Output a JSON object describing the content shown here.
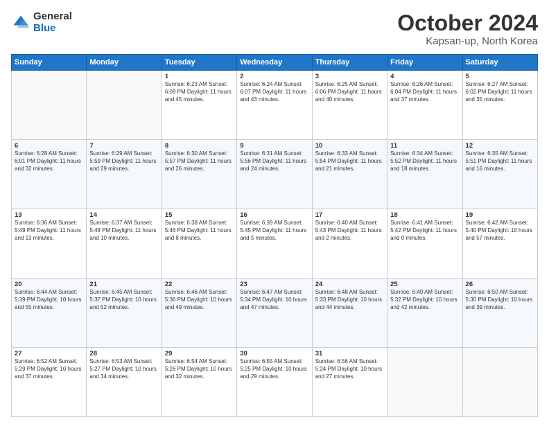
{
  "header": {
    "logo_general": "General",
    "logo_blue": "Blue",
    "title": "October 2024",
    "location": "Kapsan-up, North Korea"
  },
  "days_of_week": [
    "Sunday",
    "Monday",
    "Tuesday",
    "Wednesday",
    "Thursday",
    "Friday",
    "Saturday"
  ],
  "weeks": [
    [
      {
        "day": "",
        "info": ""
      },
      {
        "day": "",
        "info": ""
      },
      {
        "day": "1",
        "info": "Sunrise: 6:23 AM\nSunset: 6:09 PM\nDaylight: 11 hours and 45 minutes."
      },
      {
        "day": "2",
        "info": "Sunrise: 6:24 AM\nSunset: 6:07 PM\nDaylight: 11 hours and 43 minutes."
      },
      {
        "day": "3",
        "info": "Sunrise: 6:25 AM\nSunset: 6:06 PM\nDaylight: 11 hours and 40 minutes."
      },
      {
        "day": "4",
        "info": "Sunrise: 6:26 AM\nSunset: 6:04 PM\nDaylight: 11 hours and 37 minutes."
      },
      {
        "day": "5",
        "info": "Sunrise: 6:27 AM\nSunset: 6:02 PM\nDaylight: 11 hours and 35 minutes."
      }
    ],
    [
      {
        "day": "6",
        "info": "Sunrise: 6:28 AM\nSunset: 6:01 PM\nDaylight: 11 hours and 32 minutes."
      },
      {
        "day": "7",
        "info": "Sunrise: 6:29 AM\nSunset: 5:59 PM\nDaylight: 11 hours and 29 minutes."
      },
      {
        "day": "8",
        "info": "Sunrise: 6:30 AM\nSunset: 5:57 PM\nDaylight: 11 hours and 26 minutes."
      },
      {
        "day": "9",
        "info": "Sunrise: 6:31 AM\nSunset: 5:56 PM\nDaylight: 11 hours and 24 minutes."
      },
      {
        "day": "10",
        "info": "Sunrise: 6:33 AM\nSunset: 5:54 PM\nDaylight: 11 hours and 21 minutes."
      },
      {
        "day": "11",
        "info": "Sunrise: 6:34 AM\nSunset: 5:52 PM\nDaylight: 11 hours and 18 minutes."
      },
      {
        "day": "12",
        "info": "Sunrise: 6:35 AM\nSunset: 5:51 PM\nDaylight: 11 hours and 16 minutes."
      }
    ],
    [
      {
        "day": "13",
        "info": "Sunrise: 6:36 AM\nSunset: 5:49 PM\nDaylight: 11 hours and 13 minutes."
      },
      {
        "day": "14",
        "info": "Sunrise: 6:37 AM\nSunset: 5:48 PM\nDaylight: 11 hours and 10 minutes."
      },
      {
        "day": "15",
        "info": "Sunrise: 6:38 AM\nSunset: 5:46 PM\nDaylight: 11 hours and 8 minutes."
      },
      {
        "day": "16",
        "info": "Sunrise: 6:39 AM\nSunset: 5:45 PM\nDaylight: 11 hours and 5 minutes."
      },
      {
        "day": "17",
        "info": "Sunrise: 6:40 AM\nSunset: 5:43 PM\nDaylight: 11 hours and 2 minutes."
      },
      {
        "day": "18",
        "info": "Sunrise: 6:41 AM\nSunset: 5:42 PM\nDaylight: 11 hours and 0 minutes."
      },
      {
        "day": "19",
        "info": "Sunrise: 6:42 AM\nSunset: 5:40 PM\nDaylight: 10 hours and 57 minutes."
      }
    ],
    [
      {
        "day": "20",
        "info": "Sunrise: 6:44 AM\nSunset: 5:39 PM\nDaylight: 10 hours and 55 minutes."
      },
      {
        "day": "21",
        "info": "Sunrise: 6:45 AM\nSunset: 5:37 PM\nDaylight: 10 hours and 52 minutes."
      },
      {
        "day": "22",
        "info": "Sunrise: 6:46 AM\nSunset: 5:36 PM\nDaylight: 10 hours and 49 minutes."
      },
      {
        "day": "23",
        "info": "Sunrise: 6:47 AM\nSunset: 5:34 PM\nDaylight: 10 hours and 47 minutes."
      },
      {
        "day": "24",
        "info": "Sunrise: 6:48 AM\nSunset: 5:33 PM\nDaylight: 10 hours and 44 minutes."
      },
      {
        "day": "25",
        "info": "Sunrise: 6:49 AM\nSunset: 5:32 PM\nDaylight: 10 hours and 42 minutes."
      },
      {
        "day": "26",
        "info": "Sunrise: 6:50 AM\nSunset: 5:30 PM\nDaylight: 10 hours and 39 minutes."
      }
    ],
    [
      {
        "day": "27",
        "info": "Sunrise: 6:52 AM\nSunset: 5:29 PM\nDaylight: 10 hours and 37 minutes."
      },
      {
        "day": "28",
        "info": "Sunrise: 6:53 AM\nSunset: 5:27 PM\nDaylight: 10 hours and 34 minutes."
      },
      {
        "day": "29",
        "info": "Sunrise: 6:54 AM\nSunset: 5:26 PM\nDaylight: 10 hours and 32 minutes."
      },
      {
        "day": "30",
        "info": "Sunrise: 6:55 AM\nSunset: 5:25 PM\nDaylight: 10 hours and 29 minutes."
      },
      {
        "day": "31",
        "info": "Sunrise: 6:56 AM\nSunset: 5:24 PM\nDaylight: 10 hours and 27 minutes."
      },
      {
        "day": "",
        "info": ""
      },
      {
        "day": "",
        "info": ""
      }
    ]
  ]
}
